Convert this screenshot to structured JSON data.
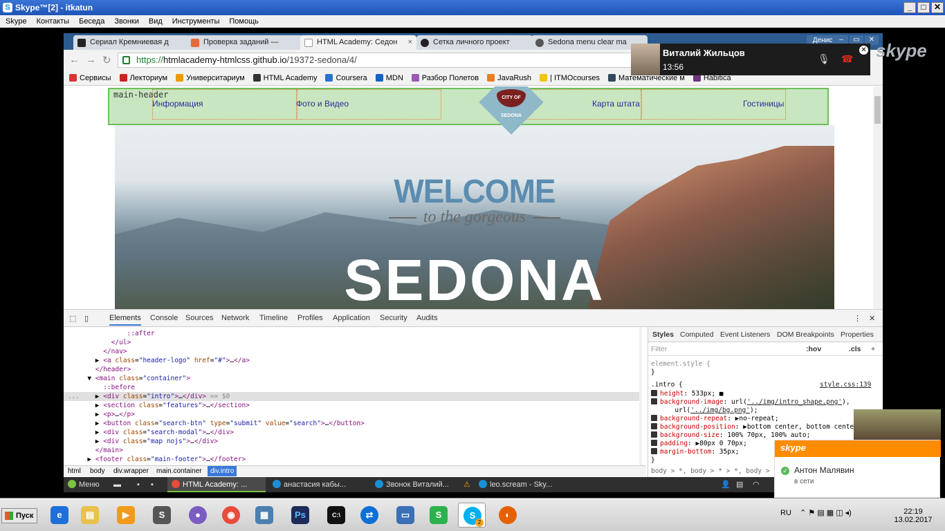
{
  "skype_window": {
    "title": "Skype™[2] - itkatun",
    "menu": [
      "Skype",
      "Контакты",
      "Беседа",
      "Звонки",
      "Вид",
      "Инструменты",
      "Помощь"
    ]
  },
  "browser": {
    "tabs": [
      {
        "label": "Сериал Кремниевая д",
        "active": false
      },
      {
        "label": "Проверка заданий —",
        "active": false
      },
      {
        "label": "HTML Academy: Седон",
        "active": true
      },
      {
        "label": "Сетка личного проект",
        "active": false
      },
      {
        "label": "Sedona menu clear ma",
        "active": false
      }
    ],
    "profile": "Денис",
    "url_scheme": "https://",
    "url_host": "htmlacademy-htmlcss.github.io",
    "url_path": "/19372-sedona/4/",
    "bookmarks": [
      "Сервисы",
      "Лекториум",
      "Университариум",
      "HTML Academy",
      "Coursera",
      "MDN",
      "Разбор Полетов",
      "JavaRush",
      "| ITMOcourses",
      "Математические м",
      "Habitica"
    ]
  },
  "page": {
    "header_label": "main-header",
    "nav": [
      "Информация",
      "Фото и Видео",
      "Карта штата",
      "Гостиницы"
    ],
    "logo_text": "CITY OF SEDONA",
    "hero_welcome": "WELCOME",
    "hero_subtitle": "to the gorgeous",
    "hero_title": "SEDONA"
  },
  "devtools": {
    "tabs": [
      "Elements",
      "Console",
      "Sources",
      "Network",
      "Timeline",
      "Profiles",
      "Application",
      "Security",
      "Audits"
    ],
    "breadcrumbs": [
      "html",
      "body",
      "div.wrapper",
      "main.container",
      "div.intro"
    ],
    "style_tabs": [
      "Styles",
      "Computed",
      "Event Listeners",
      "DOM Breakpoints",
      "Properties"
    ],
    "filter_placeholder": "Filter",
    "filter_hov": ":hov",
    "filter_cls": ".cls",
    "element_style": "element.style {",
    "rule_selector": ".intro {",
    "rule_source": "style.css:139",
    "rule_close": "}",
    "inherited": "body > *, body > * > *, body > *"
  },
  "call": {
    "name": "Виталий Жильцов",
    "time": "13:56",
    "brand": "skype"
  },
  "mint_panel": {
    "menu": "Меню",
    "tasks": [
      "HTML Academy: ...",
      "анастасия кабы...",
      "Звонок Виталий...",
      "leo.scream - Sky..."
    ]
  },
  "notification": {
    "brand": "skype",
    "name": "Антон Малявин",
    "status": "в сети"
  },
  "taskbar": {
    "start": "Пуск",
    "lang": "RU",
    "time": "22:19",
    "date": "13.02.2017",
    "skype_badge": "2"
  }
}
